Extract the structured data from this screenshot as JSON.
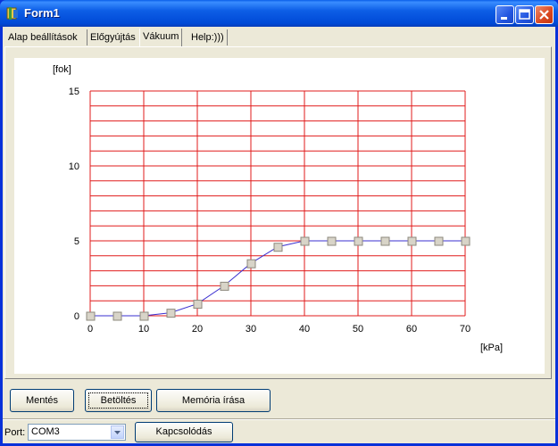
{
  "window": {
    "title": "Form1"
  },
  "tabs": [
    {
      "label": "Alap beállítások"
    },
    {
      "label": "Előgyújtás"
    },
    {
      "label": "Vákuum"
    },
    {
      "label": "Help:)))"
    }
  ],
  "chart_data": {
    "type": "line",
    "ylabel": "[fok]",
    "xlabel": "[kPa]",
    "xlim": [
      0,
      70
    ],
    "ylim": [
      0,
      15
    ],
    "x_ticks": [
      0,
      10,
      20,
      30,
      40,
      50,
      60,
      70
    ],
    "y_ticks": [
      0,
      5,
      10,
      15
    ],
    "grid": true,
    "grid_color": "#e11b1b",
    "line_color": "#3a2fd0",
    "x": [
      0,
      5,
      10,
      15,
      20,
      25,
      30,
      35,
      40,
      45,
      50,
      55,
      60,
      65,
      70
    ],
    "y": [
      0,
      0,
      0,
      0.2,
      0.8,
      2.0,
      3.5,
      4.6,
      5,
      5,
      5,
      5,
      5,
      5,
      5
    ]
  },
  "buttons": {
    "save": "Mentés",
    "load": "Betöltés",
    "write_memory": "Memória írása",
    "connect": "Kapcsolódás"
  },
  "port": {
    "label": "Port:",
    "value": "COM3"
  }
}
